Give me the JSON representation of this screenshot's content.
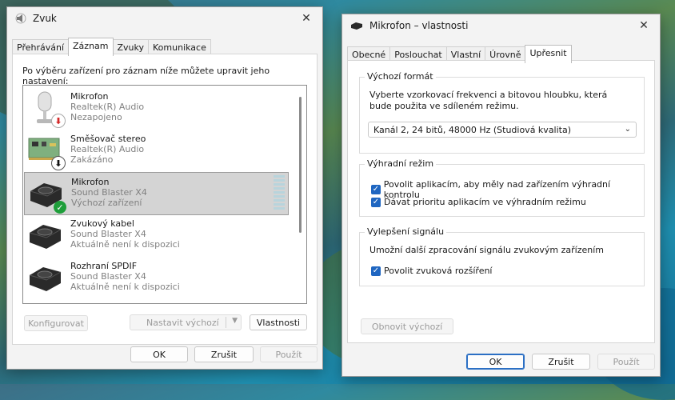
{
  "sound_window": {
    "title": "Zvuk",
    "tabs": [
      "Přehrávání",
      "Záznam",
      "Zvuky",
      "Komunikace"
    ],
    "active_tab_index": 1,
    "instruction": "Po výběru zařízení pro záznam níže můžete upravit jeho nastavení:",
    "devices": [
      {
        "name": "Mikrofon",
        "driver": "Realtek(R) Audio",
        "status": "Nezapojeno",
        "icon": "microphone-icon",
        "badge": "unplugged-red-arrow"
      },
      {
        "name": "Směšovač stereo",
        "driver": "Realtek(R) Audio",
        "status": "Zakázáno",
        "icon": "sound-card-icon",
        "badge": "disabled-black-arrow"
      },
      {
        "name": "Mikrofon",
        "driver": "Sound Blaster X4",
        "status": "Výchozí zařízení",
        "icon": "sound-blaster-icon",
        "badge": "default-green-check",
        "selected": true
      },
      {
        "name": "Zvukový kabel",
        "driver": "Sound Blaster X4",
        "status": "Aktuálně není k dispozici",
        "icon": "sound-blaster-icon"
      },
      {
        "name": "Rozhraní SPDIF",
        "driver": "Sound Blaster X4",
        "status": "Aktuálně není k dispozici",
        "icon": "sound-blaster-icon"
      }
    ],
    "buttons": {
      "configure": "Konfigurovat",
      "set_default": "Nastavit výchozí",
      "properties": "Vlastnosti",
      "ok": "OK",
      "cancel": "Zrušit",
      "apply": "Použít"
    }
  },
  "props_window": {
    "title": "Mikrofon – vlastnosti",
    "tabs": [
      "Obecné",
      "Poslouchat",
      "Vlastní",
      "Úrovně",
      "Upřesnit"
    ],
    "active_tab_index": 4,
    "default_format": {
      "group_title": "Výchozí formát",
      "description": "Vyberte vzorkovací frekvenci a bitovou hloubku, která bude použita ve sdíleném režimu.",
      "selected": "Kanál 2, 24 bitů, 48000 Hz (Studiová kvalita)"
    },
    "exclusive_mode": {
      "group_title": "Výhradní režim",
      "options": [
        {
          "label": "Povolit aplikacím, aby měly nad zařízením výhradní kontrolu",
          "checked": true
        },
        {
          "label": "Dávat prioritu aplikacím ve výhradním režimu",
          "checked": true
        }
      ]
    },
    "signal_enhancement": {
      "group_title": "Vylepšení signálu",
      "description": "Umožní další zpracování signálu zvukovým zařízením",
      "option": {
        "label": "Povolit zvuková rozšíření",
        "checked": true
      }
    },
    "buttons": {
      "restore_defaults": "Obnovit výchozí",
      "ok": "OK",
      "cancel": "Zrušit",
      "apply": "Použít"
    }
  },
  "colors": {
    "accent": "#1f66c1",
    "default_green": "#1e9e3a",
    "unplugged_red": "#d42a2a"
  }
}
